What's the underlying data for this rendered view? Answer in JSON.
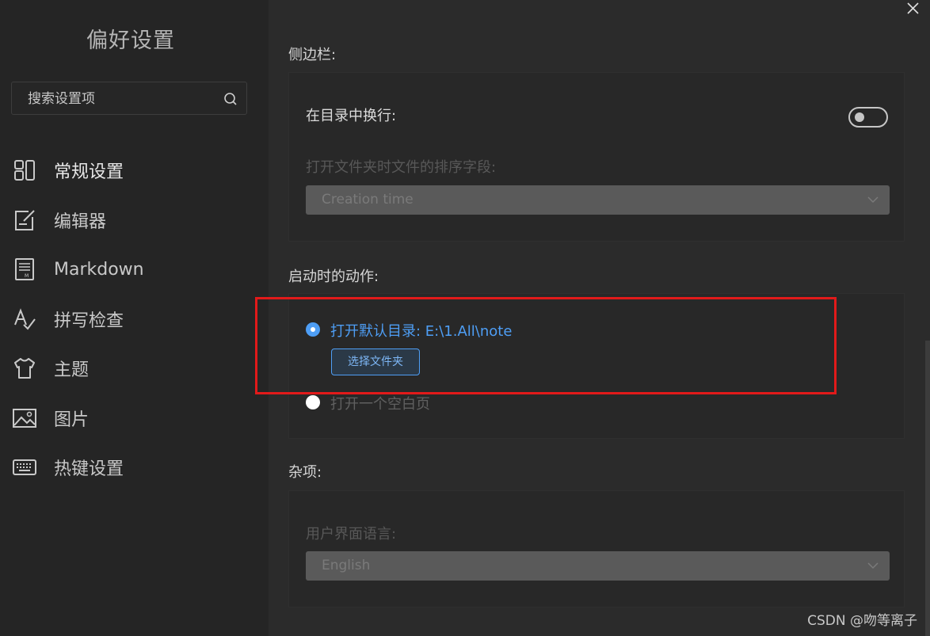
{
  "sidebar": {
    "title": "偏好设置",
    "search": {
      "placeholder": "搜索设置项",
      "icon": "search-icon"
    },
    "items": [
      {
        "label": "常规设置",
        "icon": "layout-grid-icon",
        "active": true
      },
      {
        "label": "编辑器",
        "icon": "edit-icon",
        "active": false
      },
      {
        "label": "Markdown",
        "icon": "markdown-doc-icon",
        "active": false
      },
      {
        "label": "拼写检查",
        "icon": "spellcheck-icon",
        "active": false
      },
      {
        "label": "主题",
        "icon": "shirt-icon",
        "active": false
      },
      {
        "label": "图片",
        "icon": "image-icon",
        "active": false
      },
      {
        "label": "热键设置",
        "icon": "keyboard-icon",
        "active": false
      }
    ]
  },
  "main": {
    "sidebar_section": {
      "title": "侧边栏:",
      "wrap_label": "在目录中换行:",
      "wrap_enabled": false,
      "sort_label": "打开文件夹时文件的排序字段:",
      "sort_value": "Creation time"
    },
    "startup_section": {
      "title": "启动时的动作:",
      "option_default_dir": "打开默认目录: E:\\1.All\\note",
      "option_default_dir_selected": true,
      "choose_folder_button": "选择文件夹",
      "option_blank_page": "打开一个空白页",
      "option_blank_page_selected": false
    },
    "misc_section": {
      "title": "杂项:",
      "language_label": "用户界面语言:",
      "language_value": "English"
    }
  },
  "watermark": "CSDN @吻等离子",
  "colors": {
    "accent": "#4e9ef5",
    "highlight": "#e21a1a",
    "sidebar_bg": "#252525",
    "main_bg": "#2b2b2b"
  }
}
